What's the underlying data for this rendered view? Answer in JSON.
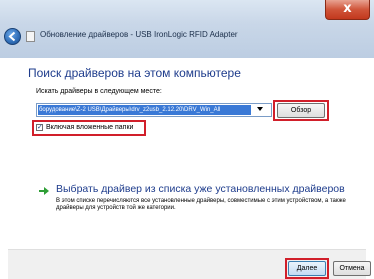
{
  "window": {
    "title": "Обновление драйверов - USB IronLogic RFID Adapter",
    "close_label": "x"
  },
  "main": {
    "heading": "Поиск драйверов на этом компьютере",
    "search_label": "Искать драйверы в следующем месте:",
    "path_value": "борудование\\Z-2 USB\\Драйверы\\drv_z2usb_2.12.20\\DRV_Win_All",
    "browse_label": "Обзор",
    "include_subfolders_label": "Включая вложенные папки",
    "include_subfolders_checked": true
  },
  "pick_from_list": {
    "title": "Выбрать драйвер из списка уже установленных драйверов",
    "description": "В этом списке перечисляются все установленные драйверы, совместимые с этим устройством, а также драйверы для устройств той же категории."
  },
  "footer": {
    "next_label": "Далее",
    "cancel_label": "Отмена"
  },
  "colors": {
    "highlight": "#d11f2a",
    "link": "#1e3c8c",
    "arrow": "#2e9e35"
  }
}
